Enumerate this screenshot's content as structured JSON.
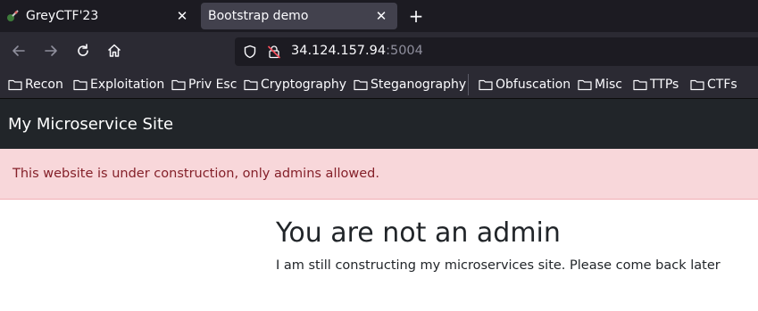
{
  "tabs": [
    {
      "title": "GreyCTF'23",
      "close_icon": "close-icon",
      "favicon": "greyctf-favicon"
    },
    {
      "title": "Bootstrap demo",
      "close_icon": "close-icon"
    }
  ],
  "nav": {
    "back_icon": "arrow-left-icon",
    "forward_icon": "arrow-right-icon",
    "reload_icon": "reload-icon",
    "home_icon": "home-icon",
    "url_host": "34.124.157.94",
    "url_port": ":5004"
  },
  "bookmarks": [
    {
      "label": "Recon"
    },
    {
      "label": "Exploitation"
    },
    {
      "label": "Priv Esc"
    },
    {
      "label": "Cryptography"
    },
    {
      "label": "Steganography"
    },
    {
      "label": "Obfuscation"
    },
    {
      "label": "Misc"
    },
    {
      "label": "TTPs"
    },
    {
      "label": "CTFs"
    }
  ],
  "page": {
    "brand": "My Microservice Site",
    "alert": "This website is under construction, only admins allowed.",
    "heading": "You are not an admin",
    "lead": "I am still constructing my microservices site. Please come back later"
  },
  "colors": {
    "tabstrip": "#1c1b22",
    "toolbar": "#2b2a33",
    "navbar_bg": "#212529",
    "alert_bg": "#f8d7da",
    "alert_text": "#842029"
  }
}
